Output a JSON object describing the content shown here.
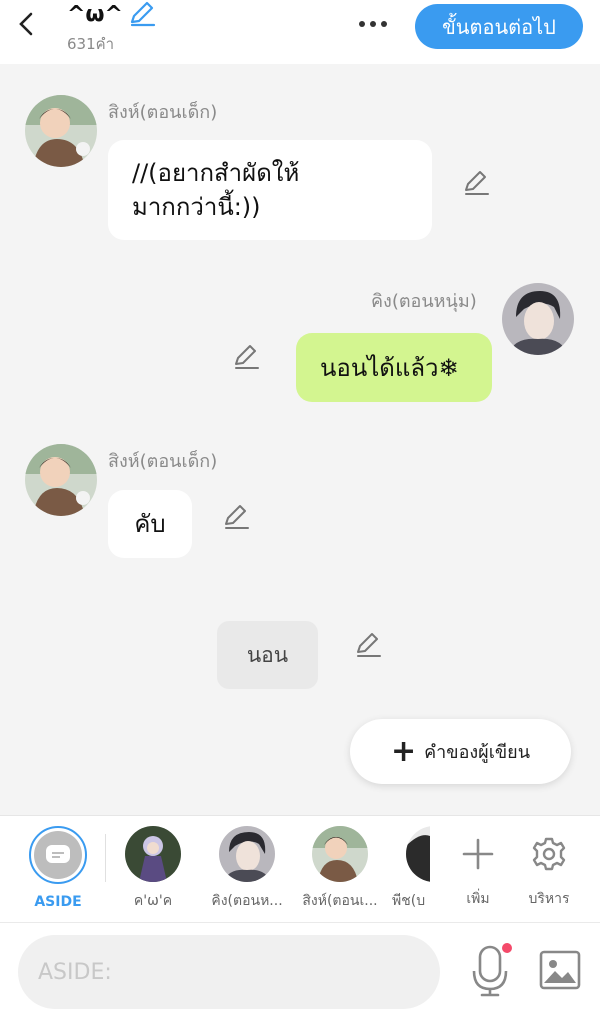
{
  "header": {
    "title": "^ω^",
    "word_count": "631คำ",
    "next_label": "ขั้นตอนต่อไป"
  },
  "messages": [
    {
      "speaker": "สิงห์(ตอนเด็ก)",
      "text": "//(อยากสำผัดให้\nมากกว่านี้:))",
      "side": "left",
      "bubble_color": "#ffffff"
    },
    {
      "speaker": "คิง(ตอนหนุ่ม)",
      "text": "นอนได้แล้ว❄",
      "side": "right",
      "bubble_color": "#d3f590"
    },
    {
      "speaker": "สิงห์(ตอนเด็ก)",
      "text": "คับ",
      "side": "left",
      "bubble_color": "#ffffff"
    },
    {
      "speaker": "",
      "text": "นอน",
      "side": "center",
      "bubble_color": "#e9e9e9"
    }
  ],
  "writer_button": {
    "label": "คำของผู้เขียน"
  },
  "characters": [
    {
      "label": "ASIDE",
      "selected": true
    },
    {
      "label": "ค'ω'ค"
    },
    {
      "label": "คิง(ตอนห..."
    },
    {
      "label": "สิงห์(ตอนเ..."
    },
    {
      "label": "พีช(บ"
    }
  ],
  "tools": {
    "add_label": "เพิ่ม",
    "manage_label": "บริหาร"
  },
  "input": {
    "placeholder": "ASIDE:"
  },
  "colors": {
    "accent": "#3a9bf0",
    "green_bubble": "#d3f590",
    "mic_badge": "#f44a6a"
  }
}
